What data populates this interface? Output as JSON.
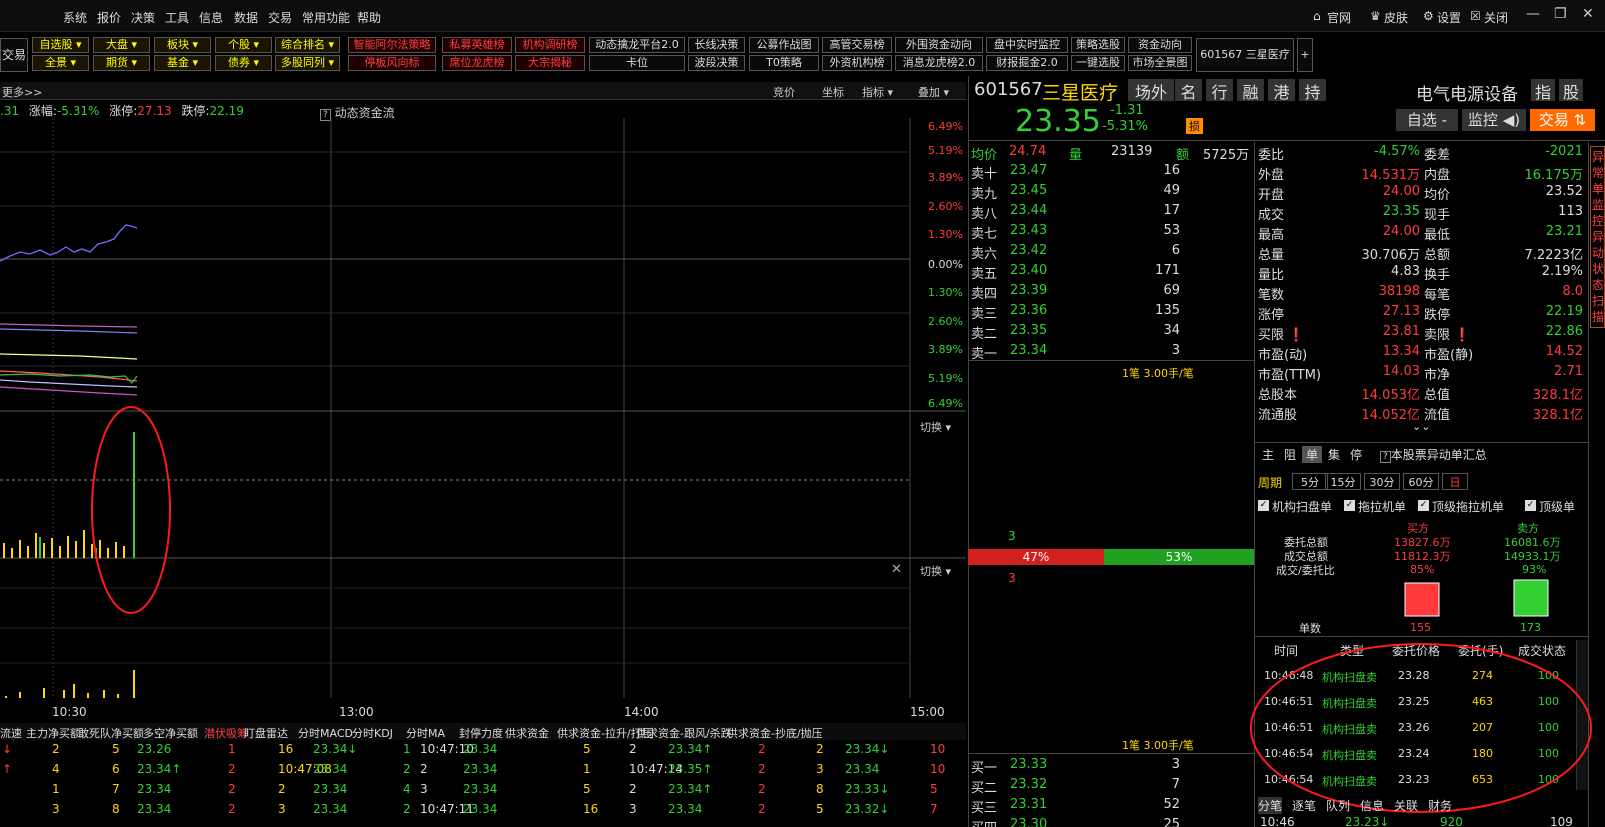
{
  "menu": [
    "系统",
    "报价",
    "决策",
    "工具",
    "信息",
    "数据",
    "交易",
    "常用功能",
    "帮助"
  ],
  "menu_right": [
    "官网",
    "皮肤",
    "设置",
    "关闭"
  ],
  "toolbar_row1": [
    [
      "自选股 ▾",
      "y"
    ],
    [
      "大盘 ▾",
      "y"
    ],
    [
      "板块 ▾",
      "y"
    ],
    [
      "个股 ▾",
      "y"
    ],
    [
      "综合排名 ▾",
      "y"
    ],
    [
      "智能阿尔法策略",
      "r"
    ],
    [
      "私募英雄榜",
      "r"
    ],
    [
      "机构调研榜",
      "r"
    ],
    [
      "动态擒龙平台2.0",
      "w"
    ],
    [
      "长线决策",
      "w"
    ],
    [
      "公募作战图",
      "w"
    ],
    [
      "高管交易榜",
      "w"
    ],
    [
      "外围资金动向",
      "w"
    ],
    [
      "盘中实时监控",
      "w"
    ],
    [
      "策略选股",
      "w"
    ],
    [
      "资金动向",
      "w"
    ]
  ],
  "toolbar_row2": [
    [
      "全景 ▾",
      "y"
    ],
    [
      "期货 ▾",
      "y"
    ],
    [
      "基金 ▾",
      "y"
    ],
    [
      "债券 ▾",
      "y"
    ],
    [
      "多股同列 ▾",
      "y"
    ],
    [
      "停板风向标",
      "r"
    ],
    [
      "席位龙虎榜",
      "r"
    ],
    [
      "大宗揭秘",
      "r"
    ],
    [
      "卡位",
      "w"
    ],
    [
      "波段决策",
      "w"
    ],
    [
      "T0策略",
      "w"
    ],
    [
      "外资机构榜",
      "w"
    ],
    [
      "消息龙虎榜2.0",
      "w"
    ],
    [
      "财报掘金2.0",
      "w"
    ],
    [
      "一键选股",
      "w"
    ],
    [
      "市场全景图",
      "w"
    ]
  ],
  "trade_btn": "交易",
  "stock_tab": "601567 三星医疗",
  "plus": "+",
  "chart_caption": {
    "more": "更多>>",
    "tabs": [
      "竞价",
      "坐标",
      "指标 ▾",
      "叠加 ▾"
    ]
  },
  "chart_info": {
    "prev": ".31",
    "zf_label": "涨幅:",
    "zf": "-5.31%",
    "zt_label": "涨停:",
    "zt": "27.13",
    "dt_label": "跌停:",
    "dt": "22.19",
    "flow": "动态资金流"
  },
  "pct_labels": [
    [
      "6.49%",
      "red"
    ],
    [
      "5.19%",
      "red"
    ],
    [
      "3.89%",
      "red"
    ],
    [
      "2.60%",
      "red"
    ],
    [
      "1.30%",
      "red"
    ],
    [
      "0.00%",
      "white"
    ],
    [
      "1.30%",
      "green"
    ],
    [
      "2.60%",
      "green"
    ],
    [
      "3.89%",
      "green"
    ],
    [
      "5.19%",
      "green"
    ],
    [
      "6.49%",
      "green"
    ]
  ],
  "switch": "切换 ▾",
  "time_axis": [
    "10:30",
    "13:00",
    "14:00",
    "15:00"
  ],
  "indicator_tabs": [
    "流速",
    "主力净买额",
    "敢死队净买额",
    "多空净买额",
    "潜伏吸筹",
    "盯盘雷达",
    "分时MACD",
    "分时KDJ",
    "分时MA",
    "封停力度",
    "供求资金",
    "供求资金-拉升/打压",
    "供求资金-跟风/杀跌",
    "供求资金-抄底/抛压"
  ],
  "bottom_rows": [
    [
      "↓",
      "2",
      "5",
      "23.26",
      "1",
      "16",
      "23.34↓",
      "1",
      "10:47:10",
      "23.34",
      "5",
      "2",
      "23.34↑",
      "2",
      "2",
      "23.34↓",
      "10"
    ],
    [
      "↑",
      "4",
      "6",
      "23.34↑",
      "2",
      "10:47:08",
      "23.34",
      "2",
      "2",
      "23.34",
      "1",
      "10:47:14",
      "23.35↑",
      "2",
      "3",
      "23.34",
      "10"
    ],
    [
      "",
      "1",
      "7",
      "23.34",
      "2",
      "2",
      "23.34",
      "4",
      "3",
      "23.34",
      "5",
      "2",
      "23.34↑",
      "2",
      "8",
      "23.33↓",
      "5"
    ],
    [
      "",
      "3",
      "8",
      "23.34",
      "2",
      "3",
      "23.34",
      "2",
      "10:47:11",
      "23.34",
      "16",
      "3",
      "23.34",
      "2",
      "5",
      "23.32↓",
      "7"
    ]
  ],
  "quote": {
    "code": "601567",
    "name": "三星医疗",
    "badges": [
      "场外",
      "名",
      "行",
      "融",
      "港",
      "持"
    ],
    "price": "23.35",
    "change": "-1.31",
    "change_pct": "-5.31%",
    "flag": "损",
    "industry": "电气电源设备",
    "industry_badge": "指",
    "industry_badge2": "股",
    "btn_fav": "自选 -",
    "btn_monitor": "监控 ◀)",
    "btn_trade": "交易 ⇅"
  },
  "avg_row": {
    "jj": "均价",
    "jj_v": "24.74",
    "l": "量",
    "l_v": "23139",
    "e": "额",
    "e_v": "5725万"
  },
  "asks": [
    [
      "卖十",
      "23.47",
      "16"
    ],
    [
      "卖九",
      "23.45",
      "49"
    ],
    [
      "卖八",
      "23.44",
      "17"
    ],
    [
      "卖七",
      "23.43",
      "53"
    ],
    [
      "卖六",
      "23.42",
      "6"
    ],
    [
      "卖五",
      "23.40",
      "171"
    ],
    [
      "卖四",
      "23.39",
      "69"
    ],
    [
      "卖三",
      "23.36",
      "135"
    ],
    [
      "卖二",
      "23.35",
      "34"
    ],
    [
      "卖一",
      "23.34",
      "3"
    ]
  ],
  "bids": [
    [
      "买一",
      "23.33",
      "3"
    ],
    [
      "买二",
      "23.32",
      "7"
    ],
    [
      "买三",
      "23.31",
      "52"
    ],
    [
      "买四",
      "23.30",
      "25"
    ]
  ],
  "per_trade": "1笔 3.00手/笔",
  "per_trade2": "1笔 3.00手/笔",
  "depth_num": "3",
  "depth_num2": "3",
  "bar_buy": "47%",
  "bar_sell": "53%",
  "stats": [
    [
      "委比",
      "-4.57%",
      "green",
      "委差",
      "-2021",
      "green"
    ],
    [
      "外盘",
      "14.531万",
      "red",
      "内盘",
      "16.175万",
      "green"
    ],
    [
      "开盘",
      "24.00",
      "red",
      "均价",
      "23.52",
      "white"
    ],
    [
      "成交",
      "23.35",
      "green",
      "现手",
      "113",
      "white"
    ],
    [
      "最高",
      "24.00",
      "red",
      "最低",
      "23.21",
      "green"
    ],
    [
      "总量",
      "30.706万",
      "white",
      "总额",
      "7.2223亿",
      "white"
    ],
    [
      "量比",
      "4.83",
      "white",
      "换手",
      "2.19%",
      "white"
    ],
    [
      "笔数",
      "38198",
      "red",
      "每笔",
      "8.0",
      "red"
    ],
    [
      "涨停",
      "27.13",
      "red",
      "跌停",
      "22.19",
      "green"
    ],
    [
      "买限 ❗",
      "23.81",
      "red",
      "卖限 ❗",
      "22.86",
      "green"
    ],
    [
      "市盈(动)",
      "13.34",
      "red",
      "市盈(静)",
      "14.52",
      "red"
    ],
    [
      "市盈(TTM)",
      "14.03",
      "red",
      "市净",
      "2.71",
      "red"
    ],
    [
      "总股本",
      "14.053亿",
      "red",
      "总值",
      "328.1亿",
      "red"
    ],
    [
      "流通股",
      "14.052亿",
      "red",
      "流值",
      "328.1亿",
      "red"
    ]
  ],
  "expand": "⌄⌄",
  "sidebar_v": [
    "异",
    "常",
    "单",
    "监",
    "控",
    "异",
    "动",
    "状",
    "态",
    "扫",
    "描"
  ],
  "tabs_right": [
    "主",
    "阻",
    "单",
    "集",
    "停"
  ],
  "abn_title": "本股票异动单汇总",
  "period_label": "周期",
  "periods": [
    "5分",
    "15分",
    "30分",
    "60分",
    "日"
  ],
  "checks": [
    "机构扫盘单",
    "拖拉机单",
    "顶级拖拉机单",
    "顶级单"
  ],
  "summary": {
    "buy_h": "买方",
    "sell_h": "卖方",
    "r1": "委托总额",
    "r1b": "13827.6万",
    "r1s": "16081.6万",
    "r2": "成交总额",
    "r2b": "11812.3万",
    "r2s": "14933.1万",
    "r3": "成交/委托比",
    "r3b": "85%",
    "r3s": "93%",
    "count_label": "单数",
    "count_b": "155",
    "count_s": "173"
  },
  "abn_headers": [
    "时间",
    "类型",
    "委托价格",
    "委托(手)",
    "成交状态"
  ],
  "abn_rows": [
    [
      "10:46:48",
      "机构扫盘卖",
      "23.28",
      "274",
      "100"
    ],
    [
      "10:46:51",
      "机构扫盘卖",
      "23.25",
      "463",
      "100"
    ],
    [
      "10:46:51",
      "机构扫盘卖",
      "23.26",
      "207",
      "100"
    ],
    [
      "10:46:54",
      "机构扫盘卖",
      "23.24",
      "180",
      "100"
    ],
    [
      "10:46:54",
      "机构扫盘卖",
      "23.23",
      "653",
      "100"
    ]
  ],
  "bottom_right_tabs": [
    "分笔",
    "逐笔",
    "队列",
    "信息",
    "关联",
    "财务"
  ],
  "last_tick": [
    "10:46",
    "23.23↓",
    "920",
    "109"
  ],
  "close_icon": "✕"
}
